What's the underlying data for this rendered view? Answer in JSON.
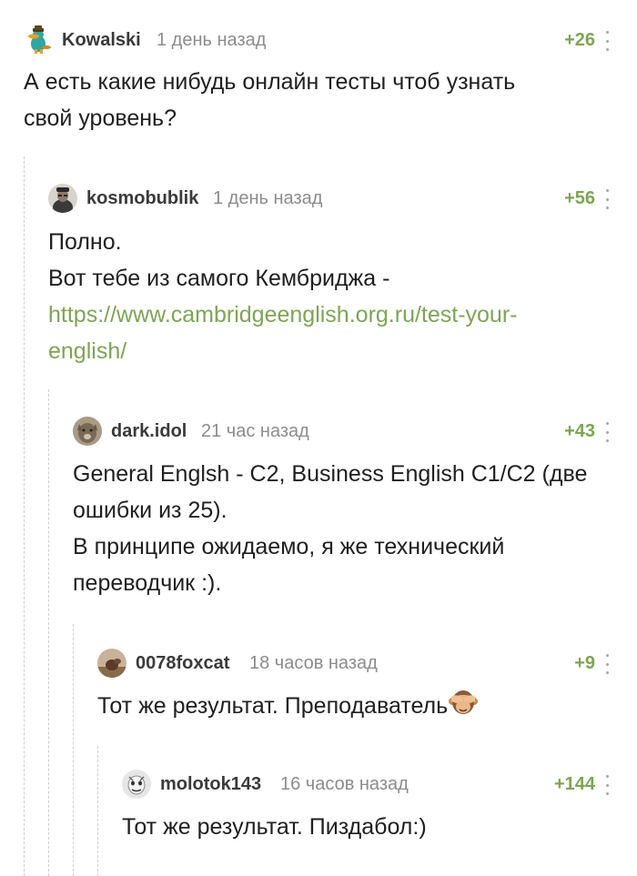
{
  "comments": [
    {
      "username": "Kowalski",
      "time": "1 день назад",
      "rating": "+26",
      "lines": [
        "А есть какие нибудь онлайн тесты чтоб узнать",
        "свой уровень?"
      ]
    },
    {
      "username": "kosmobublik",
      "time": "1 день назад",
      "rating": "+56",
      "lines": [
        "Полно.",
        "Вот тебе из самого Кембриджа -"
      ],
      "link_lines": [
        "https://www.cambridgeenglish.org.ru/test-your-",
        "english/"
      ]
    },
    {
      "username": "dark.idol",
      "time": "21 час назад",
      "rating": "+43",
      "lines": [
        "General Englsh - C2, Business English C1/C2 (две",
        "ошибки из 25).",
        "В принципе ожидаемо, я же технический",
        "переводчик :)."
      ]
    },
    {
      "username": "0078foxcat",
      "time": "18 часов назад",
      "rating": "+9",
      "lines": [
        "Тот же результат. Преподаватель"
      ]
    },
    {
      "username": "molotok143",
      "time": "16 часов назад",
      "rating": "+144",
      "lines": [
        "Тот же результат. Пиздабол:)"
      ]
    }
  ],
  "icons": {
    "menu": "more-vertical-icon",
    "emoji": "see-no-evil-monkey-icon"
  },
  "colors": {
    "rating": "#7ea554",
    "link": "#7ea554",
    "username": "#3a3a3a",
    "timestamp": "#8c8c8c"
  }
}
